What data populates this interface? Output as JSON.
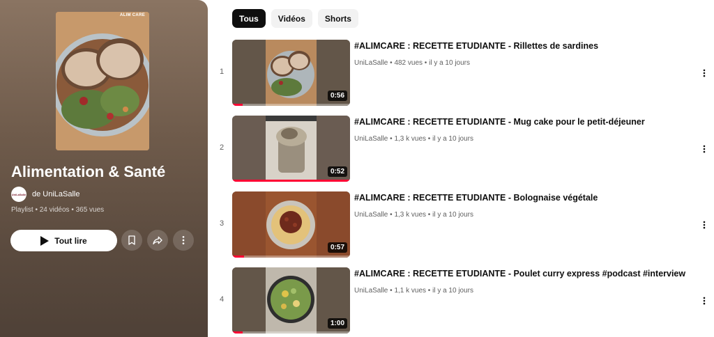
{
  "playlist": {
    "cover_logo": "ALIM CARE",
    "title": "Alimentation & Santé",
    "owner": "de UniLaSalle",
    "owner_avatar_text": "UniLaSalle",
    "meta": "Playlist • 24 vidéos • 365 vues",
    "play_all_label": "Tout lire",
    "icons": {
      "save": "bookmark-icon",
      "share": "share-icon",
      "more": "more-vert-icon"
    }
  },
  "filters": {
    "chips": [
      {
        "label": "Tous",
        "active": true
      },
      {
        "label": "Vidéos",
        "active": false
      },
      {
        "label": "Shorts",
        "active": false
      }
    ]
  },
  "videos": [
    {
      "index": "1",
      "title": "#ALIMCARE : RECETTE ETUDIANTE - Rillettes de sardines",
      "channel": "UniLaSalle",
      "views": "482 vues",
      "age": "il y a 10 jours",
      "duration": "0:56",
      "watched": 0.09,
      "bg": "#6b5e52"
    },
    {
      "index": "2",
      "title": "#ALIMCARE : RECETTE ETUDIANTE - Mug cake pour le petit-déjeuner",
      "channel": "UniLaSalle",
      "views": "1,3 k vues",
      "age": "il y a 10 jours",
      "duration": "0:52",
      "watched": 1.0,
      "bg": "#6e5f55"
    },
    {
      "index": "3",
      "title": "#ALIMCARE : RECETTE ETUDIANTE - Bolognaise végétale",
      "channel": "UniLaSalle",
      "views": "1,3 k vues",
      "age": "il y a 10 jours",
      "duration": "0:57",
      "watched": 0.1,
      "bg": "#8a4a2c"
    },
    {
      "index": "4",
      "title": "#ALIMCARE : RECETTE ETUDIANTE - Poulet curry express #podcast #interview",
      "channel": "UniLaSalle",
      "views": "1,1 k vues",
      "age": "il y a 10 jours",
      "duration": "1:00",
      "watched": 0.09,
      "bg": "#6b5e52"
    }
  ],
  "colors": {
    "accent": "#ff0033",
    "panel": "#6f5b4b",
    "chip_active": "#0f0f0f",
    "chip": "#f2f2f2"
  }
}
